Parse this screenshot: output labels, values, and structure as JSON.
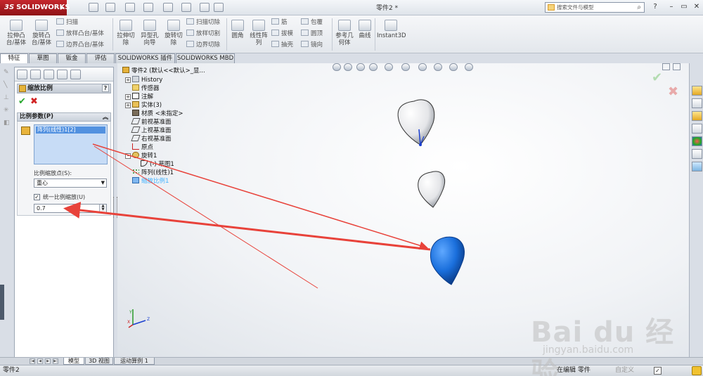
{
  "app": {
    "brand": "SOLIDWORKS",
    "document_title": "零件2 *"
  },
  "search": {
    "placeholder": "搜索文件与模型"
  },
  "ribbon": {
    "buttons": [
      {
        "label": "拉伸凸\n台/基体"
      },
      {
        "label": "旋转凸\n台/基体"
      },
      {
        "label": "扫描"
      },
      {
        "label": "放样凸台/基体"
      },
      {
        "label": "边界凸台/基体"
      },
      {
        "label": "拉伸切\n除"
      },
      {
        "label": "异型孔\n向导"
      },
      {
        "label": "旋转切\n除"
      },
      {
        "label": "扫描切除"
      },
      {
        "label": "放样切割"
      },
      {
        "label": "边界切除"
      },
      {
        "label": "圆角"
      },
      {
        "label": "线性阵\n列"
      },
      {
        "label": "筋"
      },
      {
        "label": "拔模"
      },
      {
        "label": "抽壳"
      },
      {
        "label": "包覆"
      },
      {
        "label": "圆顶"
      },
      {
        "label": "镜向"
      },
      {
        "label": "参考几\n何体"
      },
      {
        "label": "曲线"
      },
      {
        "label": "Instant3D"
      }
    ]
  },
  "tabs": [
    {
      "label": "特征"
    },
    {
      "label": "草图"
    },
    {
      "label": "钣金"
    },
    {
      "label": "评估"
    },
    {
      "label": "SOLIDWORKS 插件"
    },
    {
      "label": "SOLIDWORKS MBD"
    }
  ],
  "property_manager": {
    "title": "缩放比例",
    "help": "?",
    "group_title": "比例参数(P)",
    "selection_item": "阵列(线性)1[2]",
    "scale_about_label": "比例缩放点(S):",
    "scale_about_value": "重心",
    "uniform_label": "统一比例缩放(U)",
    "uniform_checked": true,
    "scale_value": "0.7"
  },
  "feature_tree": {
    "root": "零件2 (默认<<默认>_显...",
    "items": [
      {
        "label": "History",
        "expand": "+"
      },
      {
        "label": "传感器",
        "expand": ""
      },
      {
        "label": "注解",
        "expand": "+"
      },
      {
        "label": "实体(3)",
        "expand": "+"
      },
      {
        "label": "材质 <未指定>",
        "expand": ""
      },
      {
        "label": "前视基准面",
        "expand": ""
      },
      {
        "label": "上视基准面",
        "expand": ""
      },
      {
        "label": "右视基准面",
        "expand": ""
      },
      {
        "label": "原点",
        "expand": ""
      },
      {
        "label": "旋转1",
        "expand": "-"
      },
      {
        "label": "(-) 草图1",
        "expand": ""
      },
      {
        "label": "阵列(线性)1",
        "expand": ""
      },
      {
        "label": "缩放比例1",
        "expand": ""
      }
    ]
  },
  "bottom_tabs": [
    {
      "label": "模型"
    },
    {
      "label": "3D 视图"
    },
    {
      "label": "运动算例 1"
    }
  ],
  "status": {
    "left": "零件2",
    "editing": "在编辑 零件",
    "custom": "自定义"
  },
  "watermark": {
    "main": "Bai du 经验",
    "sub": "jingyan.baidu.com"
  },
  "colors": {
    "accent_red": "#e8423a",
    "selected_body": "#1e6fd9",
    "brand": "#b01e23"
  }
}
